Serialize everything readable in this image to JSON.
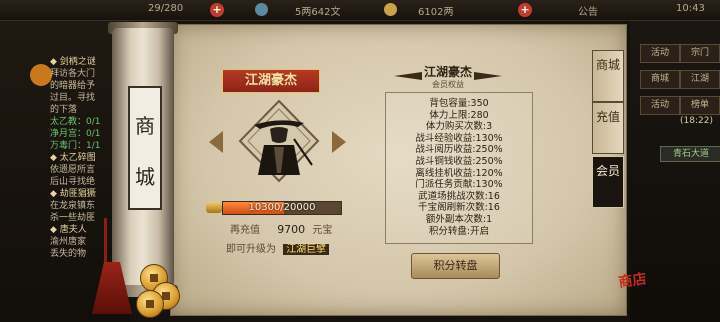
{
  "topbar": {
    "progress": "29/280",
    "copper": "5两642文",
    "silver": "6102两",
    "notice": "公告",
    "time": "10:43"
  },
  "quest_list": {
    "lines": [
      {
        "text": "◆ 剑柄之谜",
        "kind": "hd"
      },
      {
        "text": "拜访各大门",
        "kind": "n"
      },
      {
        "text": "的暗器给予",
        "kind": "n"
      },
      {
        "text": "过目。寻找",
        "kind": "n"
      },
      {
        "text": "的下落",
        "kind": "n"
      },
      {
        "text": "太乙教：0/1",
        "kind": "gr"
      },
      {
        "text": "净月宫：0/1",
        "kind": "gr"
      },
      {
        "text": "万毒门：1/1",
        "kind": "gr"
      },
      {
        "text": "◆ 太乙碎图",
        "kind": "hd"
      },
      {
        "text": "依遗愿所言",
        "kind": "n"
      },
      {
        "text": "后山寻找绝",
        "kind": "n"
      },
      {
        "text": "◆ 劫匪猖獗",
        "kind": "hd"
      },
      {
        "text": "在龙泉镇东",
        "kind": "n"
      },
      {
        "text": "杀一些劫匪",
        "kind": "n"
      },
      {
        "text": "◆ 唐夫人",
        "kind": "hd"
      },
      {
        "text": "渝州唐家",
        "kind": "n"
      },
      {
        "text": "丢失的物",
        "kind": "n"
      }
    ]
  },
  "right_menu": {
    "buttons": [
      "活动",
      "宗门",
      "商城",
      "江湖",
      "活动",
      "榜单"
    ],
    "timer": "(18:22)",
    "player_tag": "青石大道"
  },
  "scroll": {
    "label_top": "商",
    "label_bottom": "城"
  },
  "vip": {
    "title": "江湖豪杰",
    "exp_current": 10300,
    "exp_total": 20000,
    "exp_text": "10300/20000",
    "exp_fraction": 0.515,
    "recharge_label": "再充值",
    "recharge_amount": "9700",
    "recharge_unit": "元宝",
    "upgrade_label": "即可升级为",
    "upgrade_name": "江湖巨擘"
  },
  "benefits": {
    "title": "江湖豪杰",
    "subtitle": "会员权益",
    "items": [
      "背包容量:350",
      "体力上限:280",
      "体力购买次数:3",
      "战斗经验收益:130%",
      "战斗阅历收益:250%",
      "战斗铜钱收益:250%",
      "离线挂机收益:120%",
      "门派任务贡献:130%",
      "武道场挑战次数:16",
      "千宝阁刷新次数:16",
      "额外副本次数:1",
      "积分转盘:开启"
    ],
    "button": "积分转盘"
  },
  "tabs": [
    {
      "label": "商城",
      "active": false
    },
    {
      "label": "充值",
      "active": false
    },
    {
      "label": "会员",
      "active": true
    }
  ],
  "seal": "商店",
  "colors": {
    "accent_red": "#b63a26",
    "gold": "#f7e4a8",
    "exp_bar": "#ff8a3a"
  }
}
